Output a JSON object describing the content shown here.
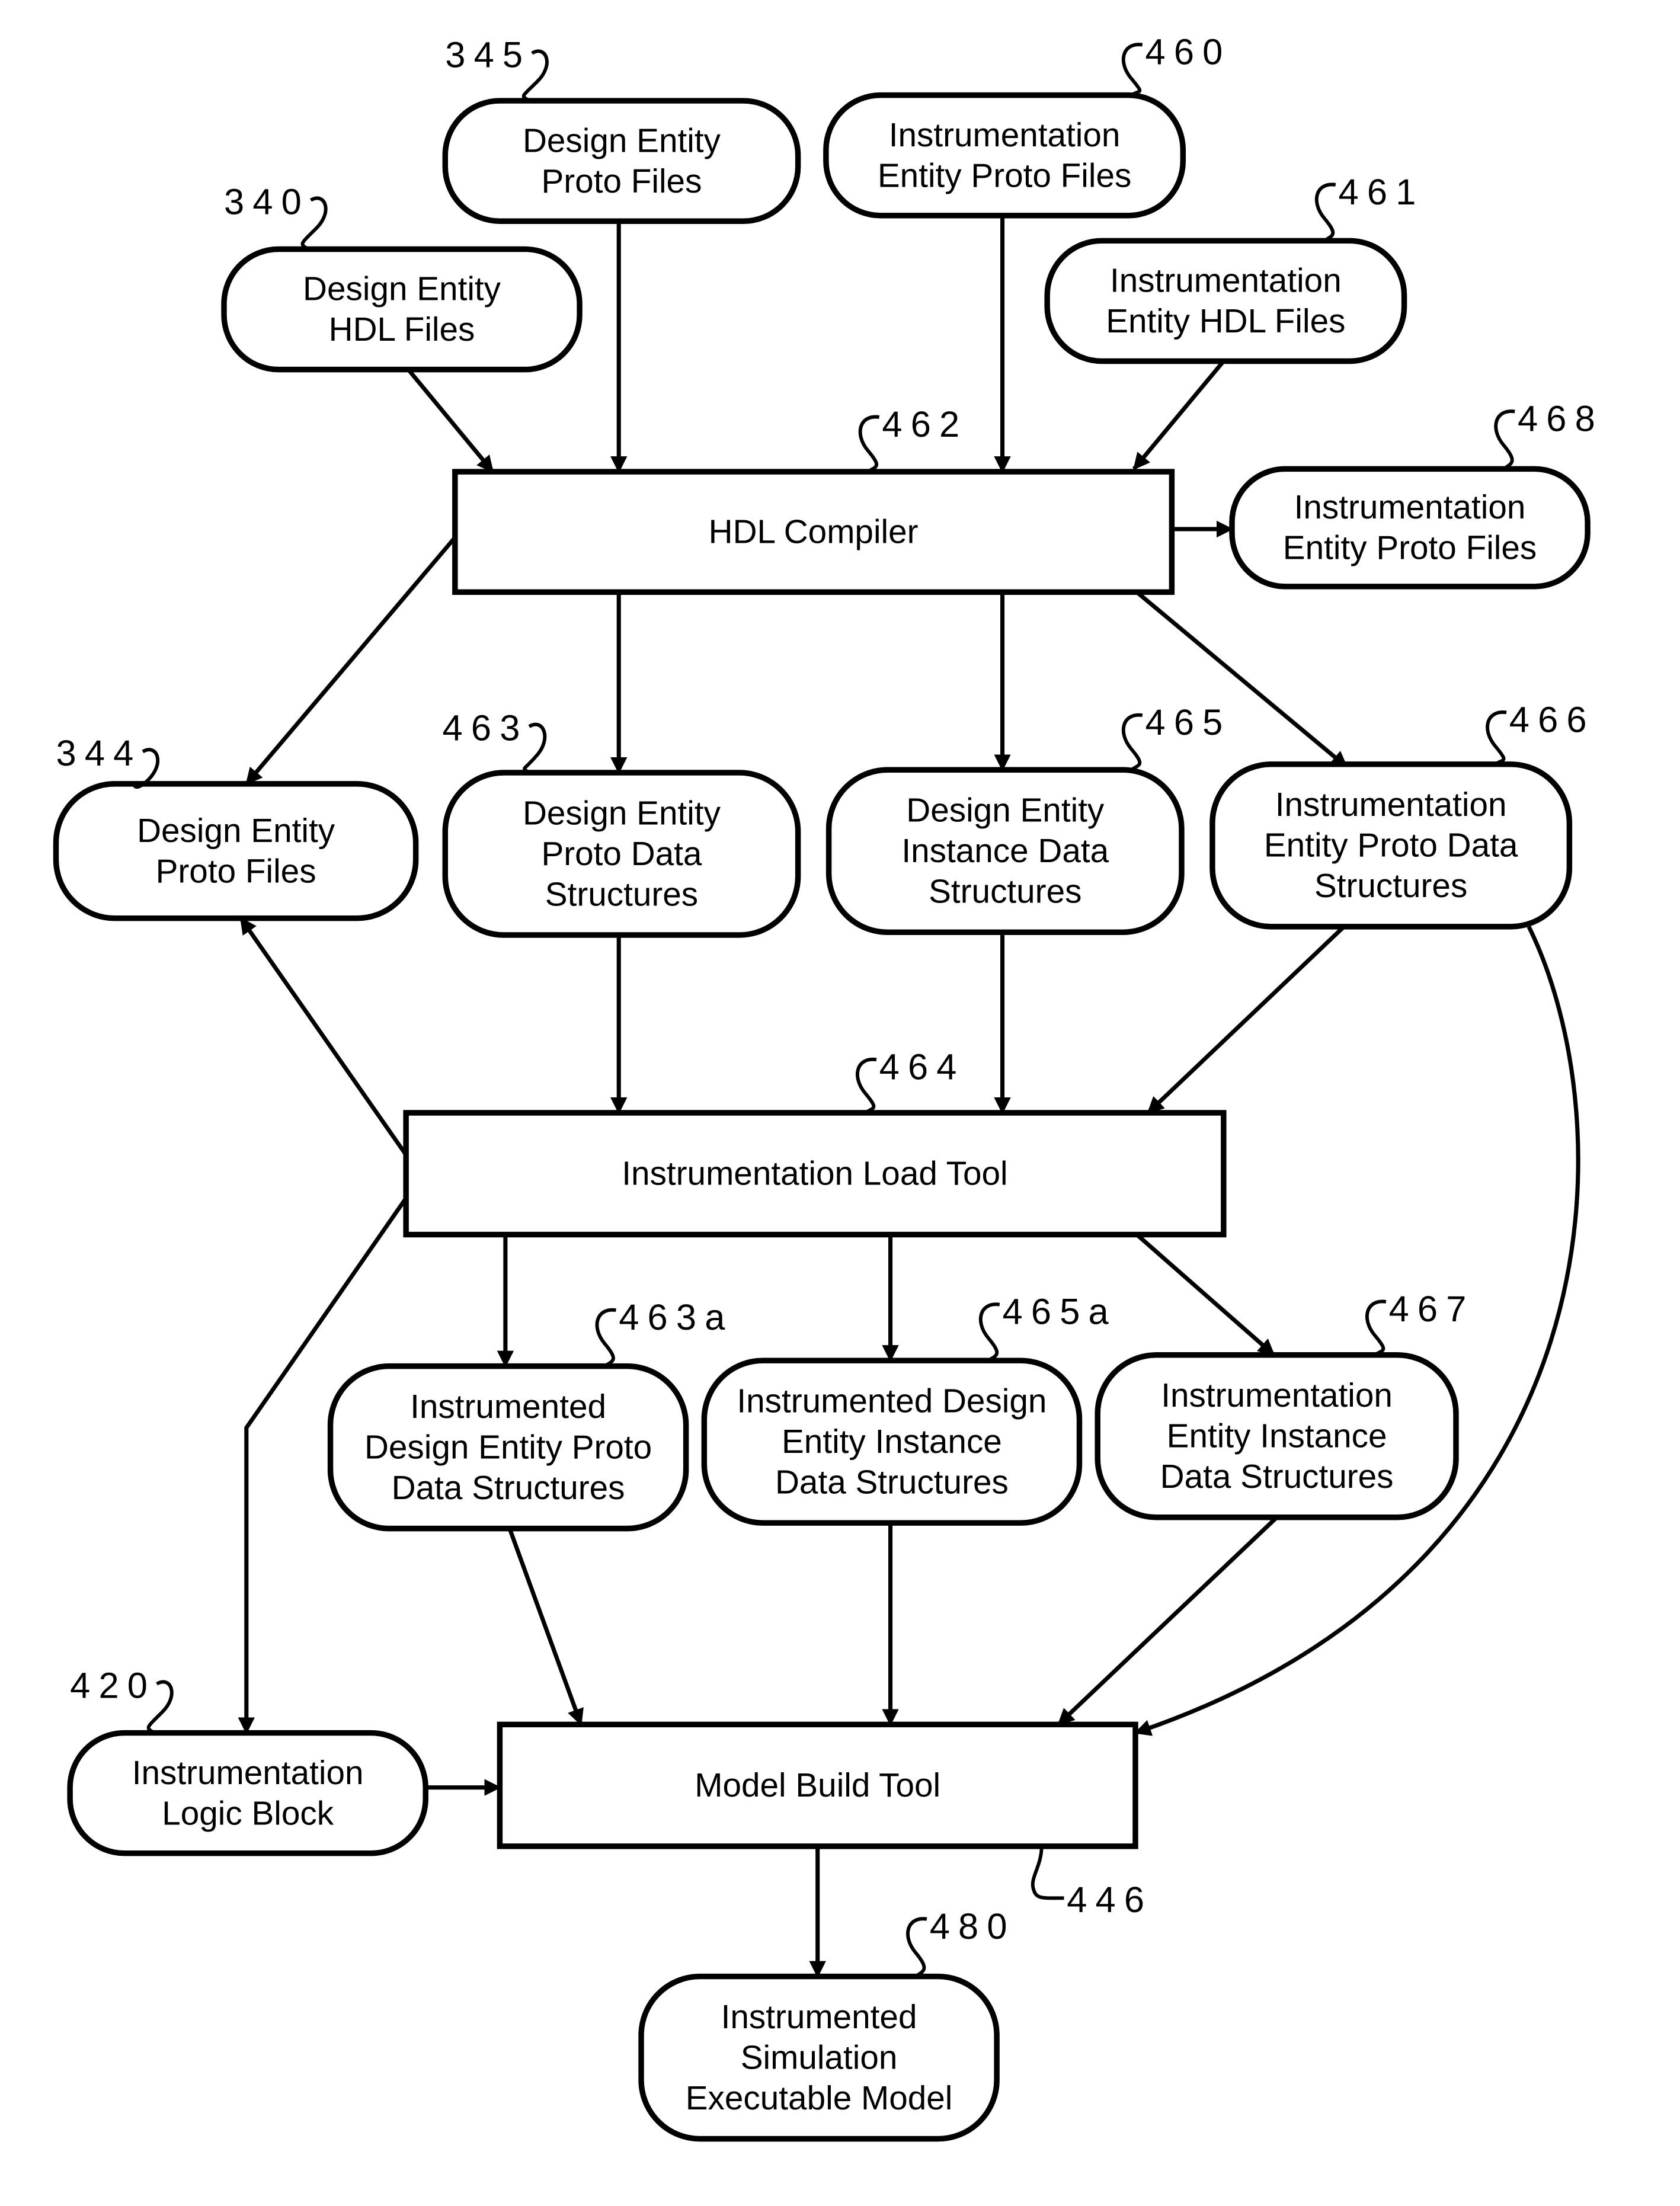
{
  "diagram": {
    "nodes": {
      "n340": {
        "ref": "340",
        "shape": "rounded",
        "lines": [
          "Design Entity",
          "HDL Files"
        ]
      },
      "n345": {
        "ref": "345",
        "shape": "rounded",
        "lines": [
          "Design Entity",
          "Proto Files"
        ]
      },
      "n460": {
        "ref": "460",
        "shape": "rounded",
        "lines": [
          "Instrumentation",
          "Entity Proto Files"
        ]
      },
      "n461": {
        "ref": "461",
        "shape": "rounded",
        "lines": [
          "Instrumentation",
          "Entity HDL Files"
        ]
      },
      "n462": {
        "ref": "462",
        "shape": "rect",
        "lines": [
          "HDL Compiler"
        ]
      },
      "n468": {
        "ref": "468",
        "shape": "rounded",
        "lines": [
          "Instrumentation",
          "Entity Proto Files"
        ]
      },
      "n344": {
        "ref": "344",
        "shape": "rounded",
        "lines": [
          "Design Entity",
          "Proto Files"
        ]
      },
      "n463": {
        "ref": "463",
        "shape": "rounded",
        "lines": [
          "Design Entity",
          "Proto Data",
          "Structures"
        ]
      },
      "n465": {
        "ref": "465",
        "shape": "rounded",
        "lines": [
          "Design Entity",
          "Instance Data",
          "Structures"
        ]
      },
      "n466": {
        "ref": "466",
        "shape": "rounded",
        "lines": [
          "Instrumentation",
          "Entity Proto Data",
          "Structures"
        ]
      },
      "n464": {
        "ref": "464",
        "shape": "rect",
        "lines": [
          "Instrumentation Load Tool"
        ]
      },
      "n463a": {
        "ref": "463a",
        "shape": "rounded",
        "lines": [
          "Instrumented",
          "Design Entity Proto",
          "Data Structures"
        ]
      },
      "n465a": {
        "ref": "465a",
        "shape": "rounded",
        "lines": [
          "Instrumented Design",
          "Entity Instance",
          "Data Structures"
        ]
      },
      "n467": {
        "ref": "467",
        "shape": "rounded",
        "lines": [
          "Instrumentation",
          "Entity Instance",
          "Data Structures"
        ]
      },
      "n420": {
        "ref": "420",
        "shape": "rounded",
        "lines": [
          "Instrumentation",
          "Logic Block"
        ]
      },
      "n446": {
        "ref": "446",
        "shape": "rect",
        "lines": [
          "Model Build Tool"
        ]
      },
      "n480": {
        "ref": "480",
        "shape": "rounded",
        "lines": [
          "Instrumented",
          "Simulation",
          "Executable Model"
        ]
      }
    },
    "edges": [
      {
        "from": "n340",
        "to": "n462"
      },
      {
        "from": "n345",
        "to": "n462"
      },
      {
        "from": "n460",
        "to": "n462"
      },
      {
        "from": "n461",
        "to": "n462"
      },
      {
        "from": "n462",
        "to": "n468"
      },
      {
        "from": "n462",
        "to": "n344"
      },
      {
        "from": "n462",
        "to": "n463"
      },
      {
        "from": "n462",
        "to": "n465"
      },
      {
        "from": "n462",
        "to": "n466"
      },
      {
        "from": "n463",
        "to": "n464"
      },
      {
        "from": "n465",
        "to": "n464"
      },
      {
        "from": "n466",
        "to": "n464"
      },
      {
        "from": "n464",
        "to": "n344"
      },
      {
        "from": "n464",
        "to": "n420"
      },
      {
        "from": "n464",
        "to": "n463a"
      },
      {
        "from": "n464",
        "to": "n465a"
      },
      {
        "from": "n464",
        "to": "n467"
      },
      {
        "from": "n466",
        "to": "n446"
      },
      {
        "from": "n463a",
        "to": "n446"
      },
      {
        "from": "n465a",
        "to": "n446"
      },
      {
        "from": "n467",
        "to": "n446"
      },
      {
        "from": "n420",
        "to": "n446"
      },
      {
        "from": "n446",
        "to": "n480"
      }
    ]
  }
}
